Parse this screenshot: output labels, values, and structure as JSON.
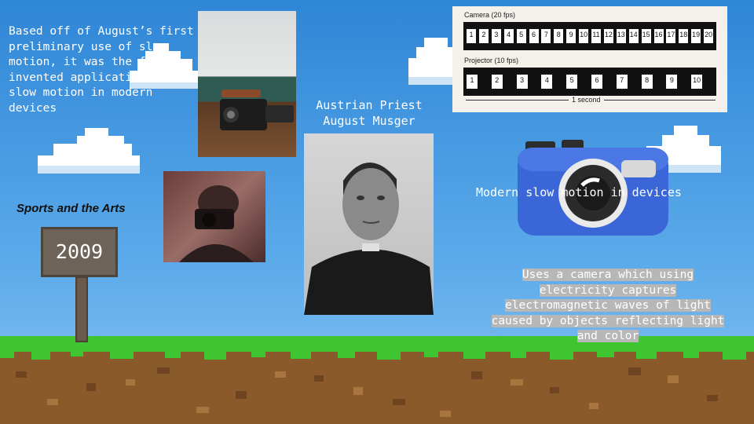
{
  "slide": {
    "intro_text": "Based off of August’s first preliminary use of slow motion, it was the first invented application of slow motion in modern devices",
    "priest_caption_line1": "Austrian Priest",
    "priest_caption_line2": "August Musger",
    "modern_caption": "Modern slow motion in devices",
    "uses_text": "Uses a camera which using electricity captures electromagnetic waves of light caused by objects reflecting light and color",
    "sports_label": "Sports and the Arts",
    "sign_year": "2009"
  },
  "diagram": {
    "camera_label": "Camera (20 fps)",
    "projector_label": "Projector (10 fps)",
    "second_label": "1 second",
    "camera_frames": [
      "1",
      "2",
      "3",
      "4",
      "5",
      "6",
      "7",
      "8",
      "9",
      "10",
      "11",
      "12",
      "13",
      "14",
      "15",
      "16",
      "17",
      "18",
      "19",
      "20"
    ],
    "projector_frames": [
      "1",
      "2",
      "3",
      "4",
      "5",
      "6",
      "7",
      "8",
      "9",
      "10"
    ]
  },
  "colors": {
    "sky_top": "#2f86d6",
    "grass": "#3fc52f",
    "dirt": "#8a5a2b",
    "camera_blue": "#3a66d8"
  }
}
